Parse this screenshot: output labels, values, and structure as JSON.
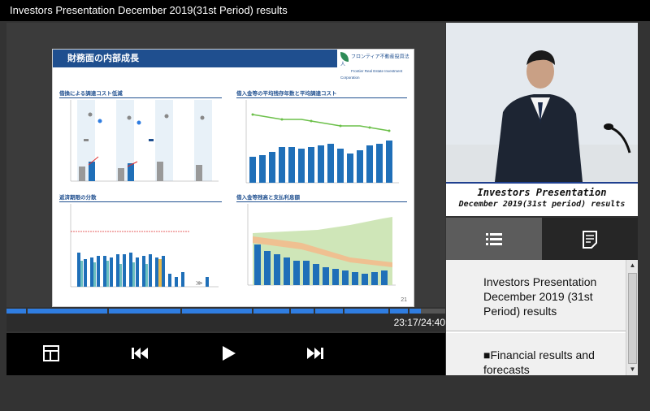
{
  "window": {
    "title": "Investors Presentation December 2019(31st Period) results"
  },
  "slide": {
    "title": "財務面の内部成長",
    "logo_line1": "フロンティア不動産投資法人",
    "logo_line2": "Frontier Real Estate Investment Corporation",
    "page_number": "21",
    "panels": {
      "top_left": {
        "title": "借換による調達コスト低減"
      },
      "top_right": {
        "title": "借入金等の平均残存年数と平均調達コスト"
      },
      "bottom_left": {
        "title": "返済期限の分散"
      },
      "bottom_right": {
        "title": "借入金等残高と支払利息額"
      }
    }
  },
  "player": {
    "time": "23:17/24:40",
    "progress": 0.945,
    "controls": {
      "layout_icon": "layout-icon",
      "prev_icon": "skip-back-icon",
      "play_icon": "play-icon",
      "next_icon": "skip-forward-icon"
    }
  },
  "video": {
    "caption_line1": "Investors Presentation",
    "caption_line2": "December 2019(31st period) results"
  },
  "sidebar": {
    "tabs": [
      {
        "icon": "list-icon",
        "active": true
      },
      {
        "icon": "document-icon",
        "active": false
      }
    ],
    "items": [
      {
        "label": "Investors Presentation December 2019 (31st Period) results"
      },
      {
        "label": "■Financial results and forecasts"
      }
    ]
  },
  "colors": {
    "accent": "#2f7de1",
    "slide_header": "#1f4f8f",
    "caption_border": "#1f3f8f"
  }
}
